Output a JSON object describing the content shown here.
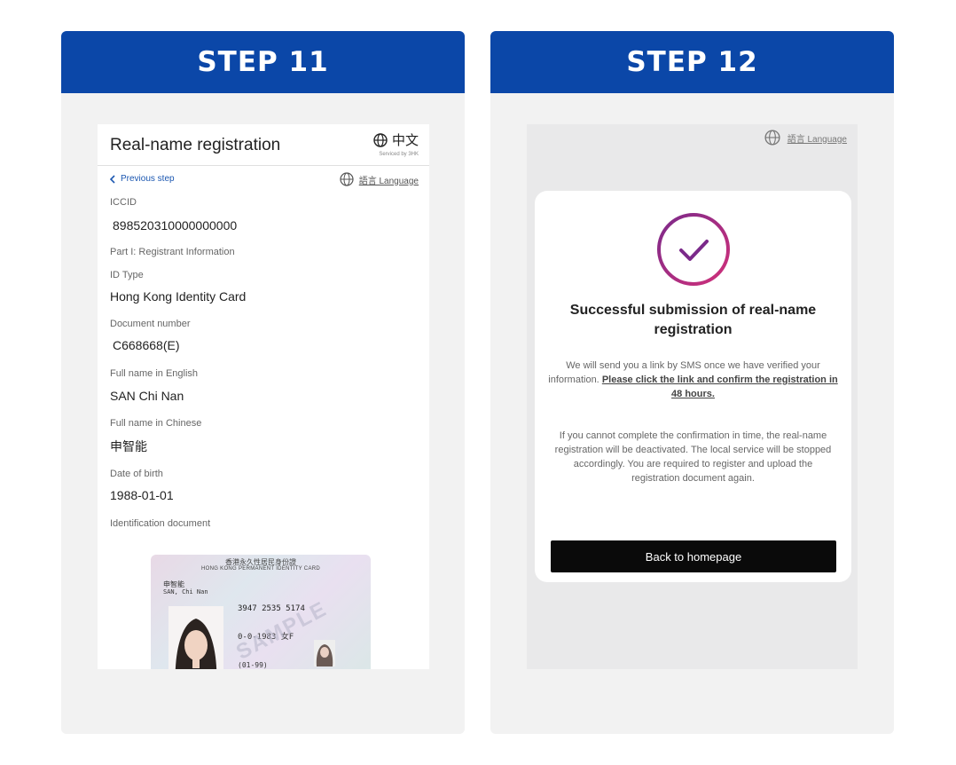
{
  "step11": {
    "header": "STEP 11",
    "app_title": "Real-name registration",
    "lang_label": "中文",
    "serviced_by": "Serviced by 3HK",
    "previous_step": "Previous step",
    "language_link": "語言 Language",
    "fields": {
      "iccid_label": "ICCID",
      "iccid_value": "898520310000000000",
      "section_label": "Part I: Registrant Information",
      "id_type_label": "ID Type",
      "id_type_value": "Hong Kong Identity Card",
      "doc_number_label": "Document number",
      "doc_number_value": "C668668(E)",
      "name_en_label": "Full name in English",
      "name_en_value": "SAN Chi Nan",
      "name_cn_label": "Full name in Chinese",
      "name_cn_value": "申智能",
      "dob_label": "Date of birth",
      "dob_value": "1988-01-01",
      "id_doc_label": "Identification document"
    },
    "id_card": {
      "title_cn": "香港永久性居民身份證",
      "title_en": "HONG KONG PERMANENT IDENTITY CARD",
      "name_cn": "申智能",
      "name_en": "SAN, Chi Nan",
      "number": "3947 2535 5174",
      "dob": "0-0-1983 女F",
      "issue": "(01-99)",
      "watermark": "SAMPLE"
    }
  },
  "step12": {
    "header": "STEP 12",
    "language_link": "語言 Language",
    "title": "Successful submission of real-name registration",
    "message_1": "We will send you a link by SMS once we have verified your information.",
    "message_1_link": "Please click the link and confirm the registration in 48 hours.",
    "message_2": "If you cannot complete the confirmation in time, the real-name registration will be deactivated. The local service will be stopped accordingly. You are required to register and upload the registration document again.",
    "button": "Back to homepage",
    "icons": {
      "success": "check-circle-icon",
      "language": "globe-icon"
    },
    "colors": {
      "check_start": "#7b2a8a",
      "check_end": "#d1307a",
      "header_bg": "#0b47a8"
    }
  }
}
